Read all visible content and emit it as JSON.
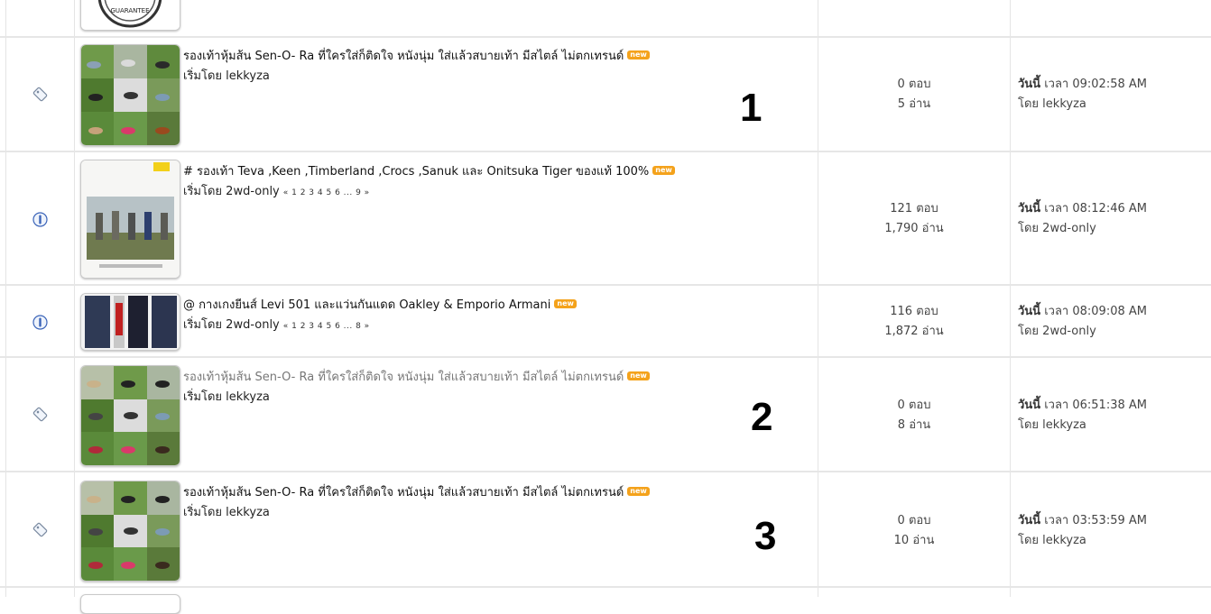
{
  "topic_rows": [
    {
      "title": "รองเท้าหุ้มส้น Sen-O- Ra ที่ใครใส่ก็ติดใจ หนังนุ่ม ใส่แล้วสบายเท้า มีสไตล์ ไม่ตกเทรนด์",
      "new_badge": "new",
      "starter": "เริ่มโดย lekkyza",
      "pages": "",
      "replies": "0 ตอบ",
      "views": "5 อ่าน",
      "last_day": "วันนี้",
      "last_time": " เวลา 09:02:58 AM",
      "last_by": "โดย lekkyza",
      "annotation": "1",
      "icon": "topic-tag-icon"
    },
    {
      "title": "# รองเท้า Teva ,Keen ,Timberland ,Crocs ,Sanuk และ Onitsuka Tiger ของแท้ 100%",
      "new_badge": "new",
      "starter": "เริ่มโดย 2wd-only",
      "pages": "« 1 2 3 4 5 6 ... 9 »",
      "replies": "121 ตอบ",
      "views": "1,790 อ่าน",
      "last_day": "วันนี้",
      "last_time": " เวลา 08:12:46 AM",
      "last_by": "โดย 2wd-only",
      "annotation": "",
      "icon": "info-icon"
    },
    {
      "title": "@ กางเกงยีนส์ Levi 501 และแว่นกันแดด Oakley & Emporio Armani",
      "new_badge": "new",
      "starter": "เริ่มโดย 2wd-only",
      "pages": "« 1 2 3 4 5 6 ... 8 »",
      "replies": "116 ตอบ",
      "views": "1,872 อ่าน",
      "last_day": "วันนี้",
      "last_time": " เวลา 08:09:08 AM",
      "last_by": "โดย 2wd-only",
      "annotation": "",
      "icon": "info-icon"
    },
    {
      "title": "รองเท้าหุ้มส้น Sen-O- Ra ที่ใครใส่ก็ติดใจ หนังนุ่ม ใส่แล้วสบายเท้า มีสไตล์ ไม่ตกเทรนด์",
      "new_badge": "new",
      "starter": "เริ่มโดย lekkyza",
      "pages": "",
      "replies": "0 ตอบ",
      "views": "8 อ่าน",
      "last_day": "วันนี้",
      "last_time": " เวลา 06:51:38 AM",
      "last_by": "โดย lekkyza",
      "annotation": "2",
      "icon": "topic-tag-icon"
    },
    {
      "title": "รองเท้าหุ้มส้น Sen-O- Ra ที่ใครใส่ก็ติดใจ หนังนุ่ม ใส่แล้วสบายเท้า มีสไตล์ ไม่ตกเทรนด์",
      "new_badge": "new",
      "starter": "เริ่มโดย lekkyza",
      "pages": "",
      "replies": "0 ตอบ",
      "views": "10 อ่าน",
      "last_day": "วันนี้",
      "last_time": " เวลา 03:53:59 AM",
      "last_by": "โดย lekkyza",
      "annotation": "3",
      "icon": "topic-tag-icon"
    }
  ],
  "top_partial": {
    "logo_text": "GUARANTEE"
  },
  "colors": {
    "new_badge": "#f4a21b",
    "divider": "#e4e4e4",
    "icon_blue": "#3a63b8"
  }
}
